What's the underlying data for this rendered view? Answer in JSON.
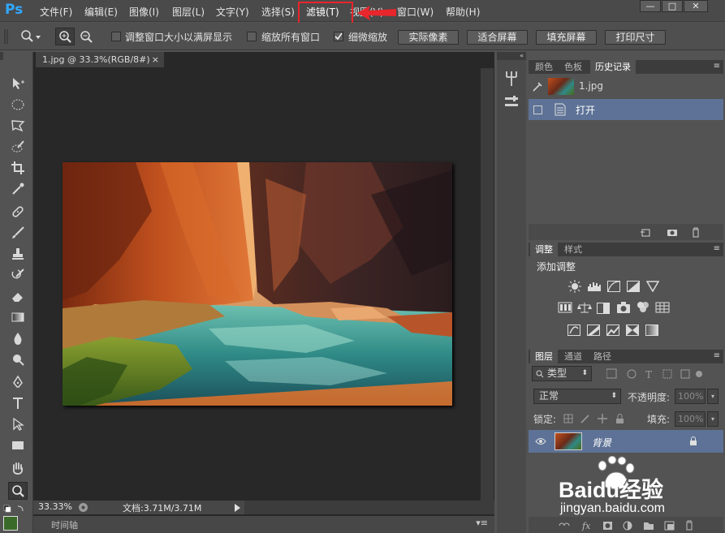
{
  "app": {
    "logo": "Ps"
  },
  "menubar": {
    "items": [
      "文件(F)",
      "编辑(E)",
      "图像(I)",
      "图层(L)",
      "文字(Y)",
      "选择(S)",
      "滤镜(T)",
      "视图(V)",
      "窗口(W)",
      "帮助(H)"
    ],
    "highlighted_item": "滤镜(T)",
    "window_controls": [
      "—",
      "□",
      "✕"
    ]
  },
  "options_bar": {
    "checkboxes": [
      {
        "label": "调整窗口大小以满屏显示",
        "checked": false
      },
      {
        "label": "缩放所有窗口",
        "checked": false
      },
      {
        "label": "细微缩放",
        "checked": true
      }
    ],
    "buttons": [
      "实际像素",
      "适合屏幕",
      "填充屏幕",
      "打印尺寸"
    ]
  },
  "document": {
    "tab_title": "1.jpg @ 33.3%(RGB/8#)",
    "tab_close": "×",
    "zoom": "33.33%",
    "doc_info": "文档:3.71M/3.71M"
  },
  "timeline": {
    "label": "时间轴"
  },
  "history_panel": {
    "tabs": [
      "颜色",
      "色板",
      "历史记录"
    ],
    "active_tab": "历史记录",
    "snapshot": "1.jpg",
    "states": [
      "打开"
    ]
  },
  "adjustments_panel": {
    "tabs": [
      "调整",
      "样式"
    ],
    "active_tab": "调整",
    "title": "添加调整"
  },
  "layers_panel": {
    "tabs": [
      "图层",
      "通道",
      "路径"
    ],
    "active_tab": "图层",
    "filter_kind": "类型",
    "blend_mode": "正常",
    "opacity_label": "不透明度:",
    "opacity_value": "100%",
    "lock_label": "锁定:",
    "fill_label": "填充:",
    "fill_value": "100%",
    "layers": [
      {
        "name": "背景",
        "locked": true,
        "visible": true
      }
    ]
  },
  "watermark": {
    "brand": "Baidu经验",
    "url": "jingyan.baidu.com"
  },
  "colors": {
    "highlight_red": "#e8262b",
    "selected_row": "#5d7296",
    "ps_blue": "#31a8ff"
  }
}
